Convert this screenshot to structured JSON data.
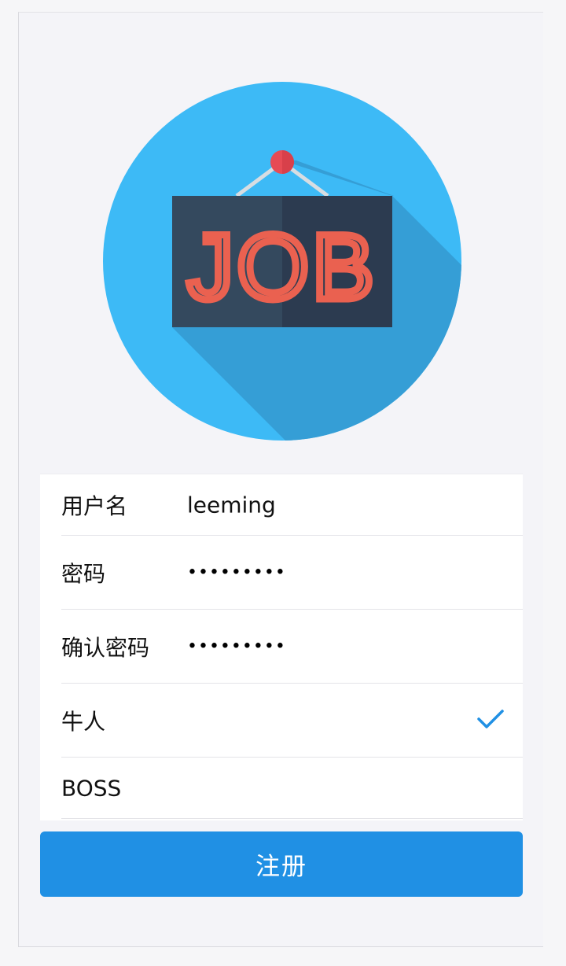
{
  "logo": {
    "name": "job-sign-logo",
    "text": "JOB",
    "colors": {
      "circle": "#3dbaf6",
      "shadow": "#359ed6",
      "board": "#34495e",
      "board_dark": "#2c3b50",
      "letters": "#e85a4f",
      "pin": "#e74b54"
    }
  },
  "form": {
    "username": {
      "label": "用户名",
      "value": "leeming"
    },
    "password": {
      "label": "密码",
      "value": "•••••••••"
    },
    "confirm_password": {
      "label": "确认密码",
      "value": "•••••••••"
    },
    "role_options": [
      {
        "label": "牛人",
        "selected": true
      },
      {
        "label": "BOSS",
        "selected": false
      }
    ]
  },
  "submit_label": "注册",
  "colors": {
    "accent": "#2090e4",
    "check": "#2090e4",
    "background": "#f4f4f8"
  }
}
